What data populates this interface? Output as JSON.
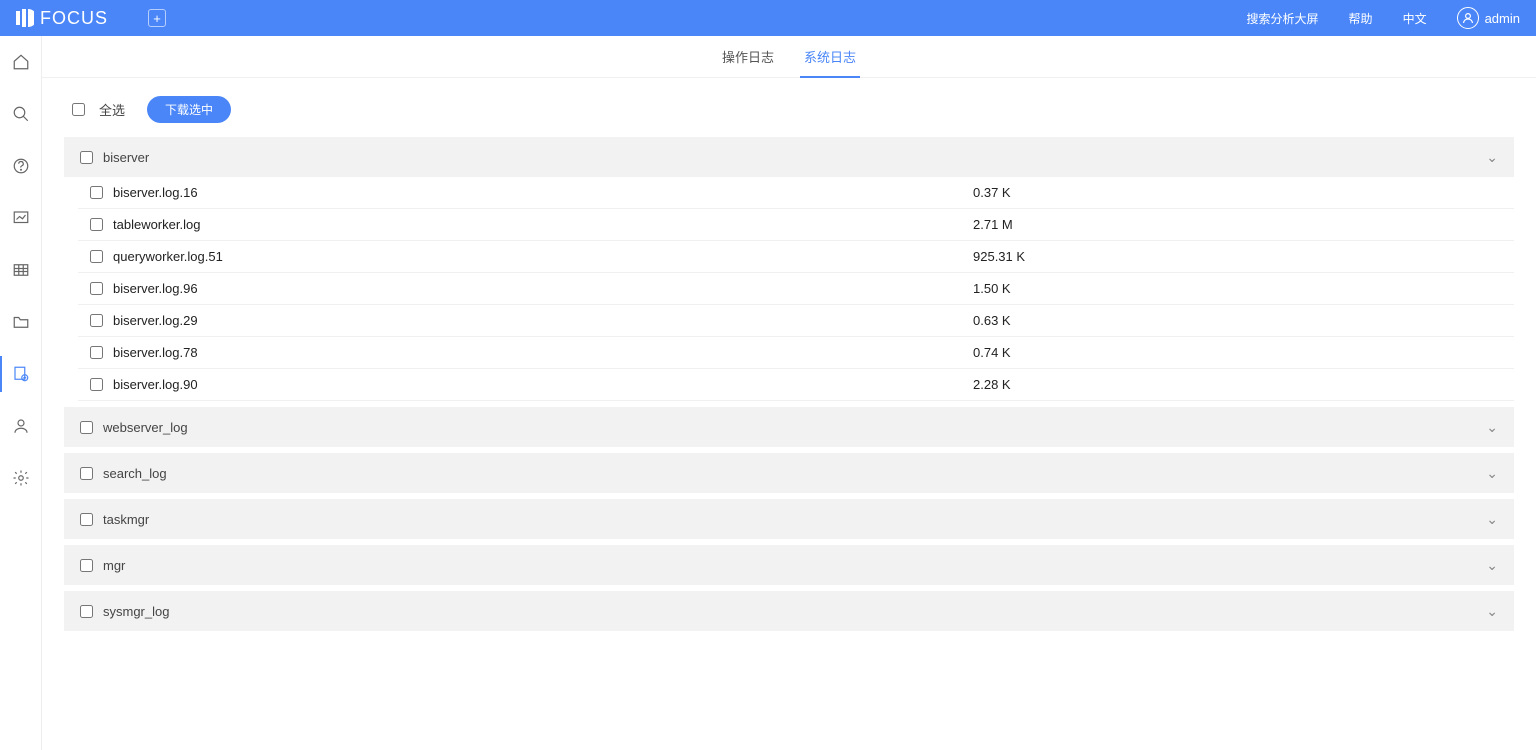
{
  "brand": "FOCUS",
  "header": {
    "links": [
      "搜索分析大屏",
      "帮助",
      "中文"
    ],
    "user": "admin"
  },
  "tabs": {
    "op_log": "操作日志",
    "sys_log": "系统日志"
  },
  "toolbar": {
    "select_all": "全选",
    "download": "下载选中"
  },
  "groups": [
    {
      "name": "biserver",
      "expanded": true,
      "files": [
        {
          "name": "biserver.log.16",
          "size": "0.37 K"
        },
        {
          "name": "tableworker.log",
          "size": "2.71 M"
        },
        {
          "name": "queryworker.log.51",
          "size": "925.31 K"
        },
        {
          "name": "biserver.log.96",
          "size": "1.50 K"
        },
        {
          "name": "biserver.log.29",
          "size": "0.63 K"
        },
        {
          "name": "biserver.log.78",
          "size": "0.74 K"
        },
        {
          "name": "biserver.log.90",
          "size": "2.28 K"
        }
      ]
    },
    {
      "name": "webserver_log",
      "expanded": false,
      "files": []
    },
    {
      "name": "search_log",
      "expanded": false,
      "files": []
    },
    {
      "name": "taskmgr",
      "expanded": false,
      "files": []
    },
    {
      "name": "mgr",
      "expanded": false,
      "files": []
    },
    {
      "name": "sysmgr_log",
      "expanded": false,
      "files": []
    }
  ]
}
